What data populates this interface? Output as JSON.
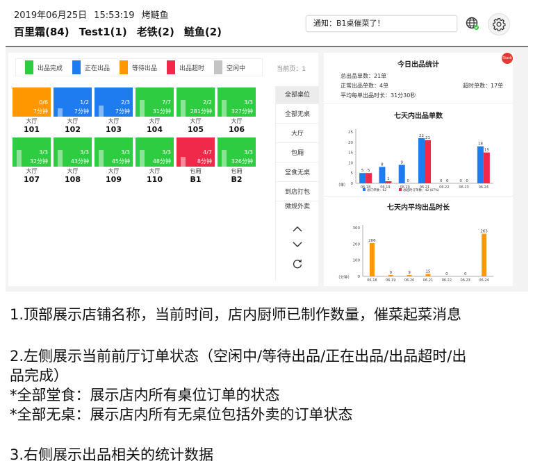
{
  "header": {
    "date": "2019年06月25日",
    "time": "15:53:19",
    "store": "烤鲢鱼",
    "chefs": [
      "百里霜(84)",
      "Test1(1)",
      "老铁(2)",
      "鲢鱼(2)"
    ],
    "notice": "通知：B1桌催菜了！",
    "globe_icon": "globe-icon",
    "gear_icon": "gear-icon"
  },
  "legend": {
    "items": [
      {
        "label": "出品完成",
        "color": "#2ecc40"
      },
      {
        "label": "正在出品",
        "color": "#1e7bf0"
      },
      {
        "label": "等待出品",
        "color": "#ff9800"
      },
      {
        "label": "出品超时",
        "color": "#f0294a"
      },
      {
        "label": "空闲中",
        "color": "#c4c4c4"
      }
    ],
    "page": "当前页：1"
  },
  "tables": [
    {
      "frac": "0/6",
      "mins": "7分钟",
      "area": "大厅",
      "num": "101",
      "color": "#ff9800",
      "progress": 0
    },
    {
      "frac": "1/2",
      "mins": "7分钟",
      "area": "大厅",
      "num": "102",
      "color": "#1e7bf0",
      "progress": 0.5
    },
    {
      "frac": "2/3",
      "mins": "7分钟",
      "area": "大厅",
      "num": "103",
      "color": "#1e7bf0",
      "progress": 0.67
    },
    {
      "frac": "7/7",
      "mins": "31分钟",
      "area": "大厅",
      "num": "104",
      "color": "#2ecc40",
      "progress": 1
    },
    {
      "frac": "2/2",
      "mins": "281分钟",
      "area": "大厅",
      "num": "105",
      "color": "#2ecc40",
      "progress": 1
    },
    {
      "frac": "3/3",
      "mins": "327分钟",
      "area": "大厅",
      "num": "106",
      "color": "#2ecc40",
      "progress": 1
    },
    {
      "frac": "3/3",
      "mins": "32分钟",
      "area": "大厅",
      "num": "107",
      "color": "#2ecc40",
      "progress": 1
    },
    {
      "frac": "3/3",
      "mins": "43分钟",
      "area": "大厅",
      "num": "108",
      "color": "#2ecc40",
      "progress": 1
    },
    {
      "frac": "3/3",
      "mins": "45分钟",
      "area": "大厅",
      "num": "109",
      "color": "#2ecc40",
      "progress": 1
    },
    {
      "frac": "3/3",
      "mins": "48分钟",
      "area": "大厅",
      "num": "110",
      "color": "#2ecc40",
      "progress": 1
    },
    {
      "frac": "4/7",
      "mins": "8分钟",
      "area": "包厢",
      "num": "B1",
      "color": "#f0294a",
      "progress": 0.57
    },
    {
      "frac": "3/3",
      "mins": "326分钟",
      "area": "包厢",
      "num": "B2",
      "color": "#2ecc40",
      "progress": 1
    }
  ],
  "filters": {
    "items": [
      "全部桌位",
      "全部无桌",
      "大厅",
      "包厢",
      "堂食无桌",
      "到店打包",
      "微规外卖"
    ],
    "active": 0
  },
  "stats": {
    "title": "今日出品统计",
    "total": "总出品单数：21单",
    "normal": "正常出品单数：4单",
    "timeout": "超时单数：17单",
    "avg": "平均每单出品时长：31分30秒",
    "badge": "Stack"
  },
  "chart_data": [
    {
      "type": "bar",
      "title": "七天内出品单数",
      "ylabel": "（单）",
      "categories": [
        "06.18",
        "06.19",
        "06.20",
        "06.21",
        "06.22",
        "06.23",
        "06.24"
      ],
      "ylim": [
        0,
        25
      ],
      "yticks": [
        0,
        5,
        10,
        15,
        20,
        25
      ],
      "legend_position": "bottom",
      "series": [
        {
          "name": "总订单数：62",
          "color": "#1e7bf0",
          "values": [
            5,
            8,
            9,
            22,
            0,
            0,
            18
          ]
        },
        {
          "name": "总超时订单数：42 (67%)",
          "color": "#f0294a",
          "values": [
            5,
            1,
            0,
            21,
            0,
            0,
            15
          ]
        }
      ]
    },
    {
      "type": "bar",
      "title": "七天内平均出品时长",
      "ylabel": "（分钟）",
      "categories": [
        "06.18",
        "06.19",
        "06.20",
        "06.21",
        "06.22",
        "06.23",
        "06.24"
      ],
      "ylim": [
        0,
        300
      ],
      "yticks": [
        0,
        100,
        200,
        300
      ],
      "series": [
        {
          "color": "#ff9800",
          "values": [
            206,
            9,
            9,
            15,
            0,
            0,
            263
          ]
        }
      ]
    }
  ],
  "captions": [
    "1.顶部展示店铺名称，当前时间，店内厨师已制作数量，催菜起菜消息",
    "2.左侧展示当前前厅订单状态（空闲中/等待出品/正在出品/出品超时/出",
    "品完成）",
    "*全部堂食：展示店内所有桌位订单的状态",
    "*全部无桌：展示店内所有无桌位包括外卖的订单状态",
    "3.右侧展示出品相关的统计数据"
  ]
}
